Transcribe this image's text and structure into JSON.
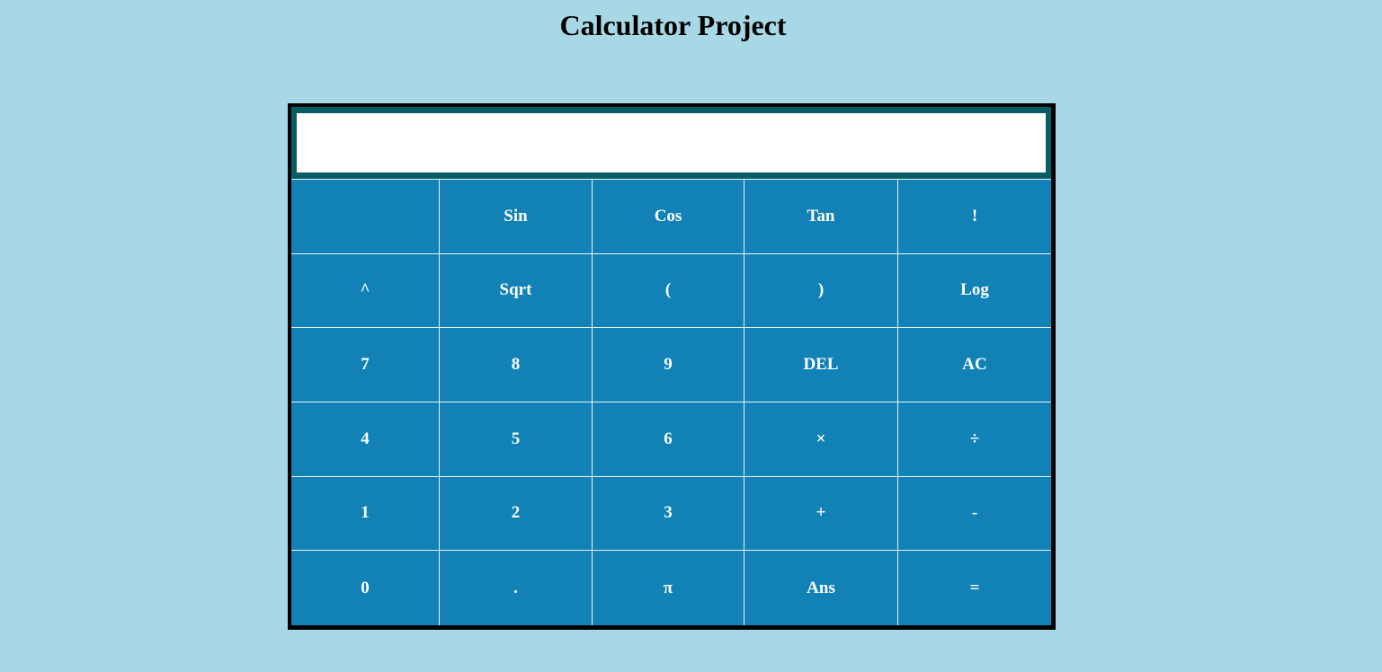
{
  "page": {
    "title": "Calculator Project"
  },
  "display": {
    "value": ""
  },
  "keys": [
    {
      "name": "blank-key",
      "label": ""
    },
    {
      "name": "sin-button",
      "label": "Sin"
    },
    {
      "name": "cos-button",
      "label": "Cos"
    },
    {
      "name": "tan-button",
      "label": "Tan"
    },
    {
      "name": "factorial-button",
      "label": "!"
    },
    {
      "name": "power-button",
      "label": "^"
    },
    {
      "name": "sqrt-button",
      "label": "Sqrt"
    },
    {
      "name": "open-paren-button",
      "label": "("
    },
    {
      "name": "close-paren-button",
      "label": ")"
    },
    {
      "name": "log-button",
      "label": "Log"
    },
    {
      "name": "digit-7-button",
      "label": "7"
    },
    {
      "name": "digit-8-button",
      "label": "8"
    },
    {
      "name": "digit-9-button",
      "label": "9"
    },
    {
      "name": "delete-button",
      "label": "DEL"
    },
    {
      "name": "all-clear-button",
      "label": "AC"
    },
    {
      "name": "digit-4-button",
      "label": "4"
    },
    {
      "name": "digit-5-button",
      "label": "5"
    },
    {
      "name": "digit-6-button",
      "label": "6"
    },
    {
      "name": "multiply-button",
      "label": "×"
    },
    {
      "name": "divide-button",
      "label": "÷"
    },
    {
      "name": "digit-1-button",
      "label": "1"
    },
    {
      "name": "digit-2-button",
      "label": "2"
    },
    {
      "name": "digit-3-button",
      "label": "3"
    },
    {
      "name": "add-button",
      "label": "+"
    },
    {
      "name": "subtract-button",
      "label": "-"
    },
    {
      "name": "digit-0-button",
      "label": "0"
    },
    {
      "name": "decimal-button",
      "label": "."
    },
    {
      "name": "pi-button",
      "label": "π"
    },
    {
      "name": "answer-button",
      "label": "Ans"
    },
    {
      "name": "equals-button",
      "label": "="
    }
  ],
  "colors": {
    "background": "#a8d8e5",
    "keypad": "#1282b6",
    "display_frame": "#085c63",
    "calculator_border": "#000000"
  }
}
